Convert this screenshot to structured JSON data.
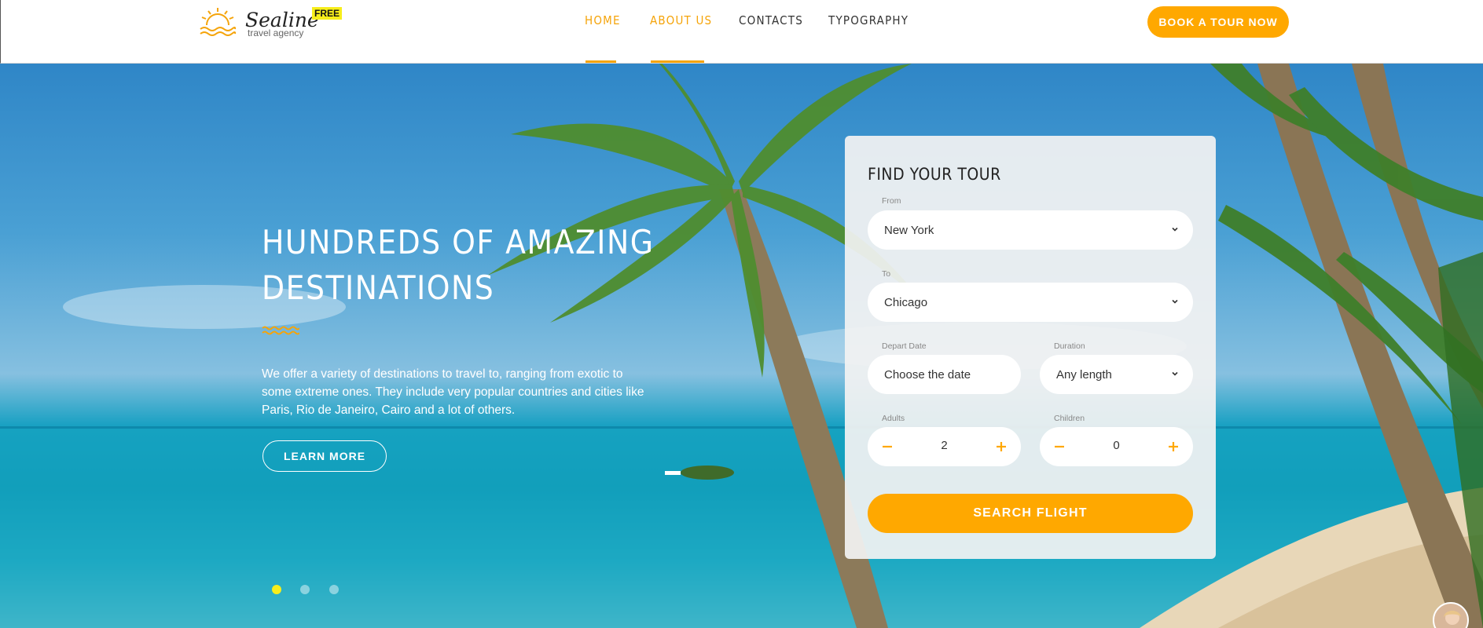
{
  "brand": {
    "name": "Sealine",
    "tagline": "travel agency",
    "badge": "FREE"
  },
  "nav": {
    "items": [
      {
        "label": "HOME",
        "active": true
      },
      {
        "label": "ABOUT US",
        "active": true
      },
      {
        "label": "CONTACTS",
        "active": false
      },
      {
        "label": "TYPOGRAPHY",
        "active": false
      }
    ],
    "cta_label": "BOOK A TOUR NOW"
  },
  "hero": {
    "title_line1": "HUNDREDS OF AMAZING",
    "title_line2": "DESTINATIONS",
    "text": "We offer a variety of destinations to travel to, ranging from exotic to some extreme ones. They include very popular countries and cities like Paris, Rio de Janeiro, Cairo and a lot of others.",
    "button_label": "LEARN MORE",
    "slides": 3,
    "active_slide": 1
  },
  "search": {
    "title": "FIND YOUR TOUR",
    "from_label": "From",
    "from_value": "New York",
    "to_label": "To",
    "to_value": "Chicago",
    "depart_label": "Depart Date",
    "depart_value": "Choose the date",
    "duration_label": "Duration",
    "duration_value": "Any length",
    "adults_label": "Adults",
    "adults_value": "2",
    "children_label": "Children",
    "children_value": "0",
    "button_label": "SEARCH FLIGHT"
  },
  "colors": {
    "accent": "#ffa800",
    "badge": "#f7ee1b",
    "dot_active": "#f7ee1b"
  }
}
